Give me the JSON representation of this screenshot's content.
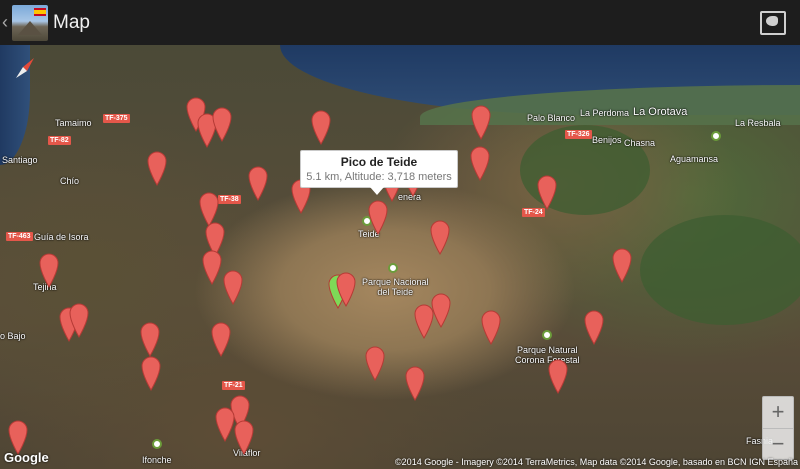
{
  "appbar": {
    "title": "Map",
    "up_glyph": "‹",
    "icon": "app-icon",
    "action_icon": "map-layers-icon"
  },
  "bubble": {
    "title": "Pico de Teide",
    "subtitle": "5.1 km, Altitude: 3,718 meters"
  },
  "places": [
    {
      "label": "Tamaimo"
    },
    {
      "label": "Santiago"
    },
    {
      "label": "Chío"
    },
    {
      "label": "Guía de Isora"
    },
    {
      "label": "Tejina"
    },
    {
      "label": "o Bajo"
    },
    {
      "label": "Palo Blanco"
    },
    {
      "label": "La Perdoma"
    },
    {
      "label": "La Orotava"
    },
    {
      "label": "La Resbala"
    },
    {
      "label": "Benijos"
    },
    {
      "label": "Chasna"
    },
    {
      "label": "Aguamansa"
    },
    {
      "label": "Teide"
    },
    {
      "label": "Parque Nacional\ndel Teide"
    },
    {
      "label": "Parque Natural\nCorona Forestal"
    },
    {
      "label": "Ifonche"
    },
    {
      "label": "Vilaflor"
    },
    {
      "label": "Fasnia"
    },
    {
      "label": "enera"
    }
  ],
  "roads": [
    {
      "label": "TF-375"
    },
    {
      "label": "TF-82"
    },
    {
      "label": "TF-38"
    },
    {
      "label": "TF-463"
    },
    {
      "label": "TF-326"
    },
    {
      "label": "TF-24"
    },
    {
      "label": "TF-21"
    }
  ],
  "map": {
    "zoom_in": "+",
    "zoom_out": "−",
    "google_logo": "Google",
    "attribution": "©2014 Google - Imagery ©2014 TerraMetrics, Map data ©2014 Google, basado en BCN IGN España"
  },
  "colors": {
    "pin_red": "#e8615b",
    "pin_selected": "#7ed957",
    "appbar": "#1d1d1d"
  }
}
